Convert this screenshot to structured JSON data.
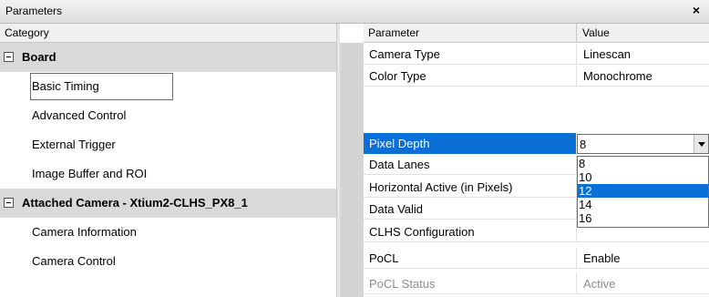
{
  "window": {
    "title": "Parameters",
    "close_glyph": "×"
  },
  "left": {
    "header": "Category",
    "rows": [
      {
        "kind": "group",
        "label": "Board"
      },
      {
        "kind": "child",
        "label": "Basic Timing",
        "selected": true
      },
      {
        "kind": "child",
        "label": "Advanced Control"
      },
      {
        "kind": "child",
        "label": "External Trigger"
      },
      {
        "kind": "child",
        "label": "Image Buffer and ROI"
      },
      {
        "kind": "group",
        "label": "Attached Camera - Xtium2-CLHS_PX8_1"
      },
      {
        "kind": "child",
        "label": "Camera Information"
      },
      {
        "kind": "child",
        "label": "Camera Control"
      }
    ]
  },
  "grid": {
    "header_param": "Parameter",
    "header_value": "Value",
    "rows": [
      {
        "name": "Camera Type",
        "value": "Linescan"
      },
      {
        "name": "Color Type",
        "value": "Monochrome"
      },
      {
        "name": "Pixel Depth",
        "value": "8"
      },
      {
        "name": "Data Lanes",
        "value": ""
      },
      {
        "name": "Horizontal Active (in Pixels)",
        "value": ""
      },
      {
        "name": "Data Valid",
        "value": ""
      },
      {
        "name": "CLHS Configuration",
        "value": ""
      },
      {
        "name": "PoCL",
        "value": "Enable"
      },
      {
        "name": "PoCL Status",
        "value": "Active"
      }
    ],
    "dropdown_options": [
      "8",
      "10",
      "12",
      "14",
      "16"
    ],
    "highlighted_option": "12"
  },
  "colors": {
    "selection": "#0a6fd6",
    "group_bg": "#d9d9d9"
  }
}
